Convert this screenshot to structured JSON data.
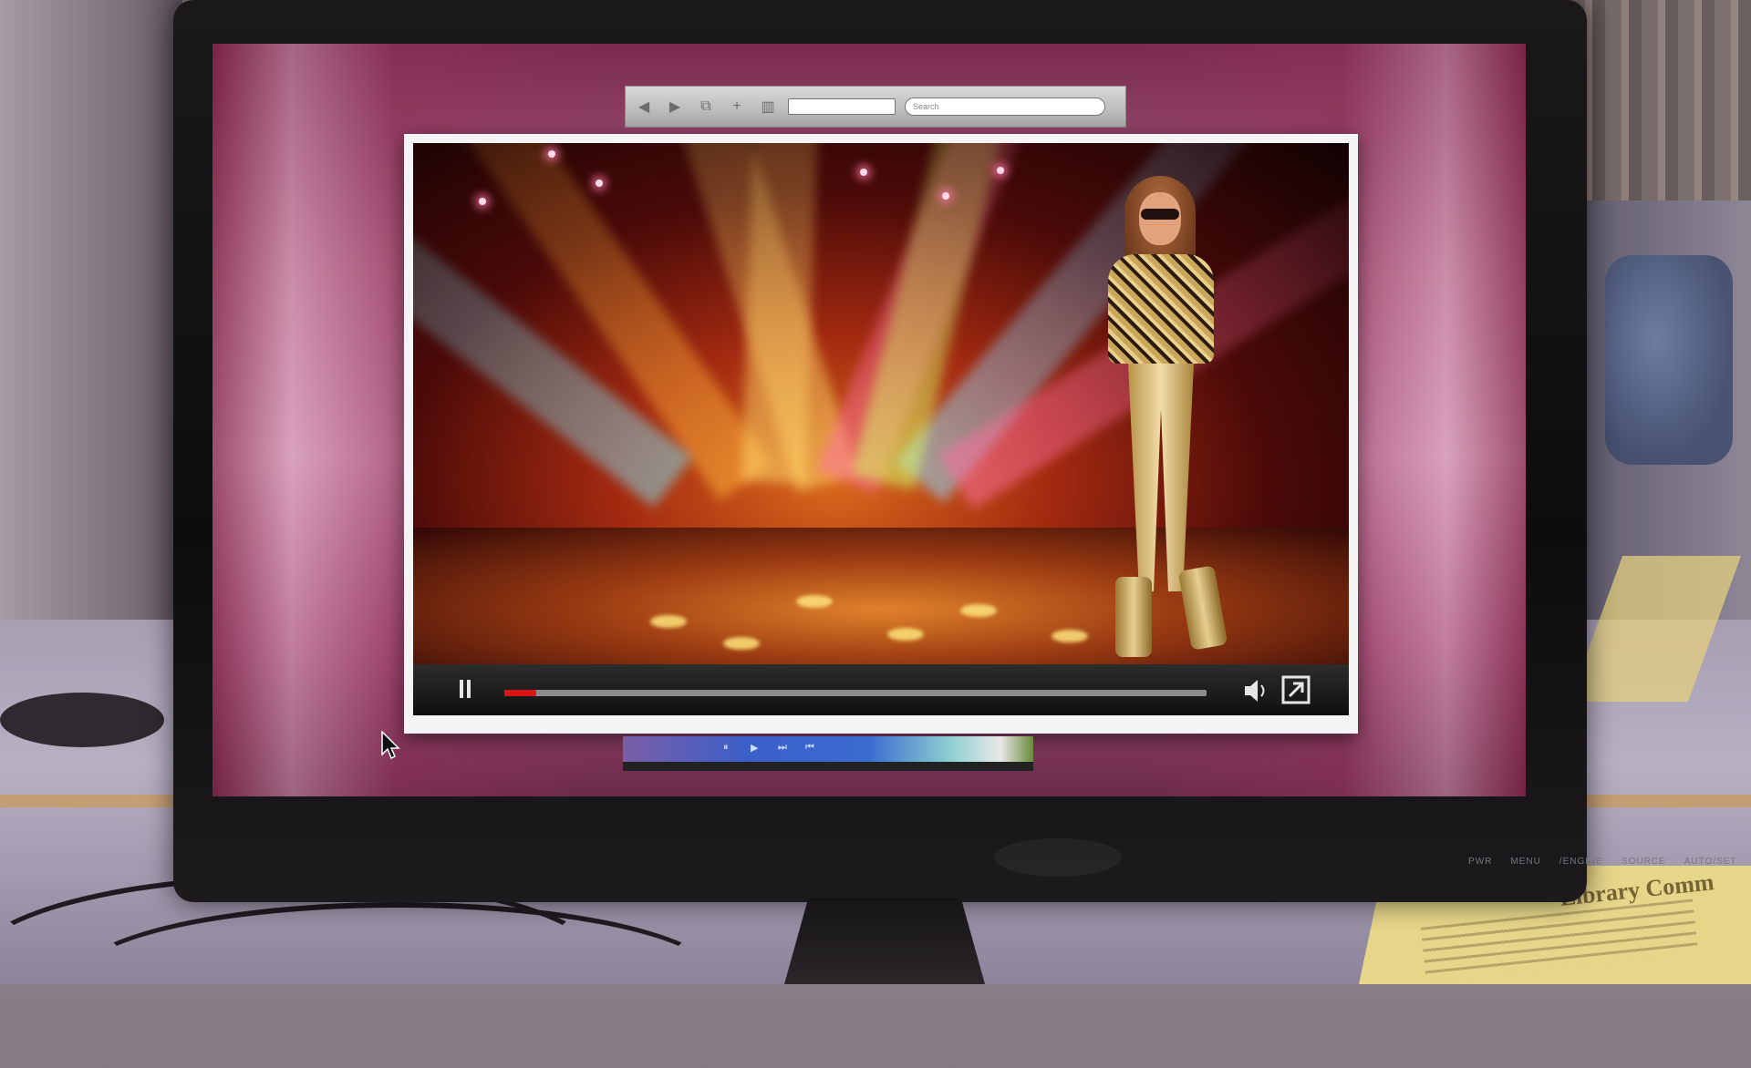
{
  "browser": {
    "search_placeholder": "Search"
  },
  "toolbar_icons": [
    "back-arrow-icon",
    "forward-arrow-icon",
    "tabs-icon",
    "add-tab-icon",
    "bookmarks-icon"
  ],
  "player": {
    "progress_fraction": 0.045,
    "playing": true
  },
  "dock": {
    "items": [
      "⏸",
      "▶",
      "⏭",
      "⏮"
    ]
  },
  "monitor": {
    "buttons": [
      "PWR",
      "MENU",
      "/ENGINE",
      "SOURCE",
      "AUTO/SET"
    ]
  },
  "notice": {
    "title": "Library Comm"
  },
  "colors": {
    "progress": "#d81414",
    "screen_bg": "#b06686"
  }
}
